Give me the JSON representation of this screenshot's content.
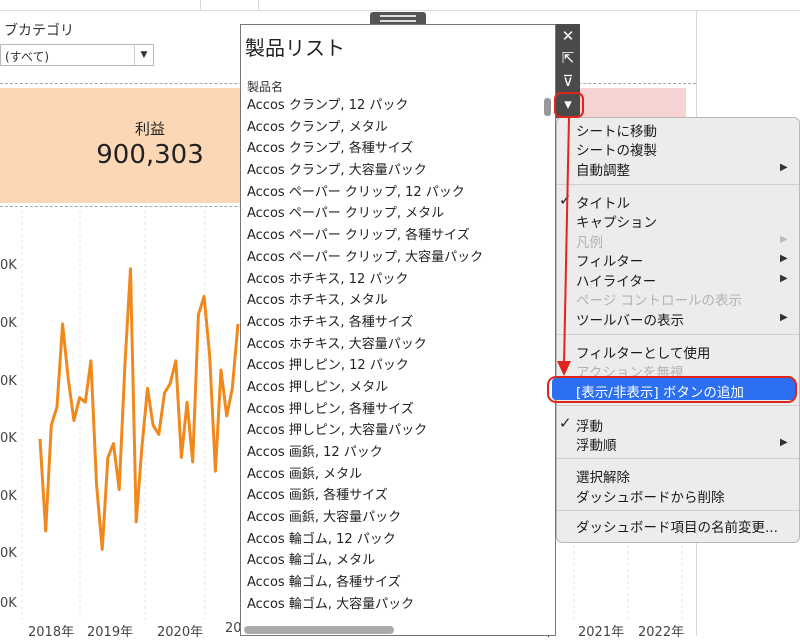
{
  "background": {
    "subcategory_label": "ブカテゴリ",
    "subcategory_value": "(すべて)",
    "kpi": {
      "label": "利益",
      "value": "900,303"
    },
    "y_axis_labels": [
      "0K",
      "0K",
      "0K",
      "0K",
      "0K",
      "0K",
      "0K"
    ],
    "x_axis_labels": [
      "2018年",
      "2019年",
      "2020年",
      "20",
      "0年",
      "2021年",
      "2022年"
    ],
    "line_chart": {
      "type": "line",
      "series_color": "#f0891d",
      "values": [
        35,
        15,
        38,
        42,
        60,
        48,
        39,
        44,
        43,
        52,
        25,
        11,
        31,
        34,
        24,
        51,
        72,
        17,
        33,
        46,
        38,
        36,
        45,
        47,
        52,
        31,
        43,
        30,
        62,
        66,
        53,
        28,
        50,
        40,
        46,
        60
      ]
    }
  },
  "panel": {
    "title": "製品リスト",
    "field_label": "製品名",
    "items": [
      "Accos クランプ, 12 パック",
      "Accos クランプ, メタル",
      "Accos クランプ, 各種サイズ",
      "Accos クランプ, 大容量パック",
      "Accos ペーパー クリップ, 12 パック",
      "Accos ペーパー クリップ, メタル",
      "Accos ペーパー クリップ, 各種サイズ",
      "Accos ペーパー クリップ, 大容量パック",
      "Accos ホチキス, 12 パック",
      "Accos ホチキス, メタル",
      "Accos ホチキス, 各種サイズ",
      "Accos ホチキス, 大容量パック",
      "Accos 押しピン, 12 パック",
      "Accos 押しピン, メタル",
      "Accos 押しピン, 各種サイズ",
      "Accos 押しピン, 大容量パック",
      "Accos 画鋲, 12 パック",
      "Accos 画鋲, メタル",
      "Accos 画鋲, 各種サイズ",
      "Accos 画鋲, 大容量パック",
      "Accos 輪ゴム, 12 パック",
      "Accos 輪ゴム, メタル",
      "Accos 輪ゴム, 各種サイズ",
      "Accos 輪ゴム, 大容量パック"
    ]
  },
  "toolbar": {
    "close_icon": "✕",
    "goto_icon": "⇱",
    "filter_icon": "⊽",
    "more_icon": "▾"
  },
  "menu": {
    "goto_sheet": "シートに移動",
    "duplicate_sheet": "シートの複製",
    "auto_fit": "自動調整",
    "title": "タイトル",
    "caption": "キャプション",
    "legend": "凡例",
    "filter": "フィルター",
    "highlighter": "ハイライター",
    "page_controls": "ページ コントロールの表示",
    "toolbar": "ツールバーの表示",
    "use_as_filter": "フィルターとして使用",
    "ignore_actions": "アクションを無視",
    "add_show_hide": "[表示/非表示] ボタンの追加",
    "floating": "浮動",
    "floating_order": "浮動順",
    "deselect": "選択解除",
    "remove_from_dashboard": "ダッシュボードから削除",
    "rename_item": "ダッシュボード項目の名前変更...",
    "checkmark": "✓",
    "submenu_arrow": "▶"
  },
  "colors": {
    "highlight": "#2c6ff0",
    "annotation_red": "#e0261c",
    "line_orange": "#f0891d"
  }
}
